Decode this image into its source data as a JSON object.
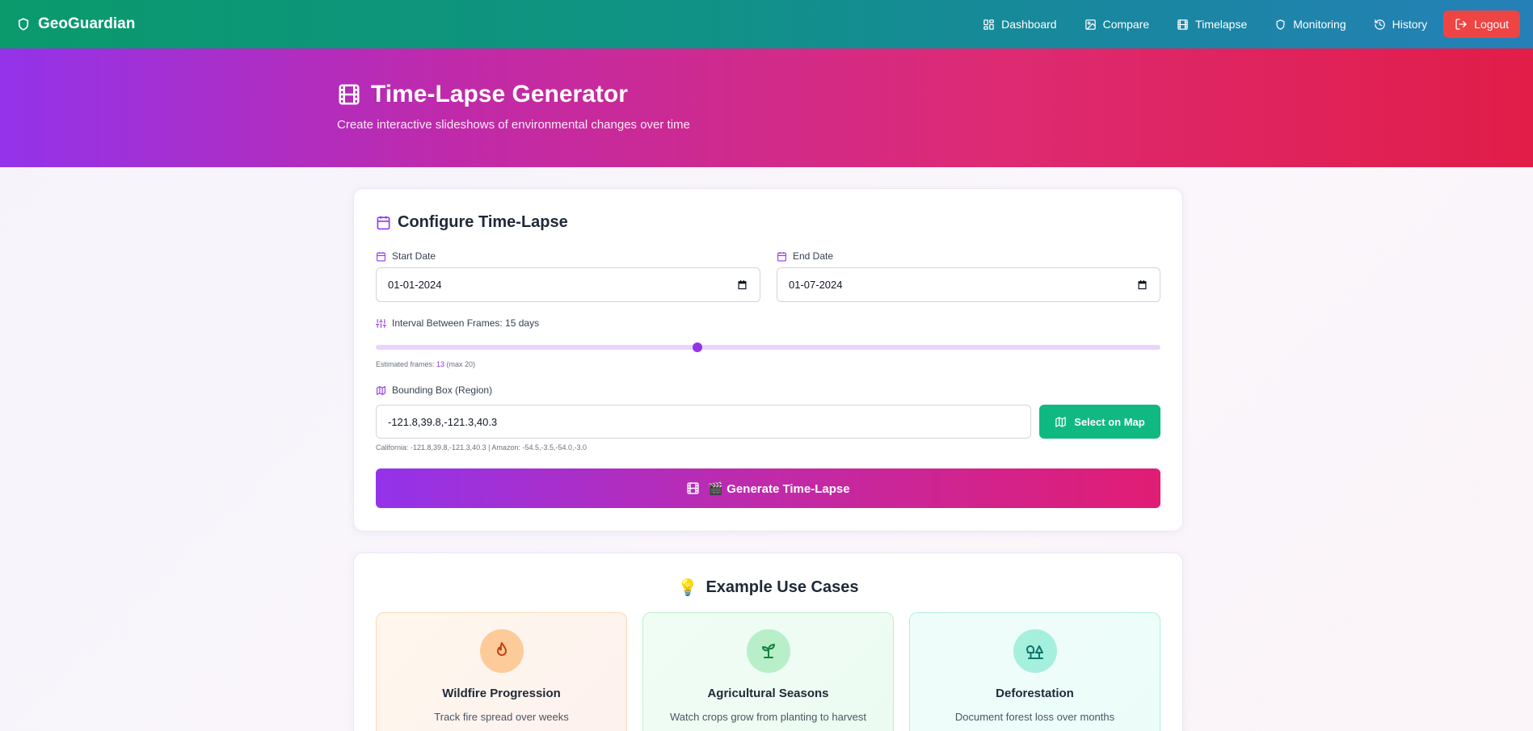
{
  "nav": {
    "brand": "GeoGuardian",
    "links": [
      {
        "label": "Dashboard",
        "icon": "dashboard-icon"
      },
      {
        "label": "Compare",
        "icon": "image-icon"
      },
      {
        "label": "Timelapse",
        "icon": "film-icon"
      },
      {
        "label": "Monitoring",
        "icon": "shield-icon"
      },
      {
        "label": "History",
        "icon": "history-icon"
      }
    ],
    "logout": "Logout"
  },
  "hero": {
    "title": "Time-Lapse Generator",
    "subtitle": "Create interactive slideshows of environmental changes over time"
  },
  "config": {
    "title": "Configure Time-Lapse",
    "start_label": "Start Date",
    "start_value": "01-01-2024",
    "end_label": "End Date",
    "end_value": "01-07-2024",
    "interval_label": "Interval Between Frames: 15 days",
    "interval_fraction": 0.41,
    "est_prefix": "Estimated frames: ",
    "est_value": "13",
    "est_suffix": " (max 20)",
    "bbox_label": "Bounding Box (Region)",
    "bbox_value": "-121.8,39.8,-121.3,40.3",
    "bbox_hint": "California: -121.8,39.8,-121.3,40.3 | Amazon: -54.5,-3.5,-54.0,-3.0",
    "map_button": "Select on Map",
    "generate_button": "🎬 Generate Time-Lapse"
  },
  "uses": {
    "title": "Example Use Cases",
    "title_emoji": "💡",
    "items": [
      {
        "title": "Wildfire Progression",
        "desc": "Track fire spread over weeks"
      },
      {
        "title": "Agricultural Seasons",
        "desc": "Watch crops grow from planting to harvest"
      },
      {
        "title": "Deforestation",
        "desc": "Document forest loss over months"
      }
    ]
  },
  "colors": {
    "accent": "#9333ea",
    "success": "#10b981",
    "danger": "#ef4444"
  }
}
